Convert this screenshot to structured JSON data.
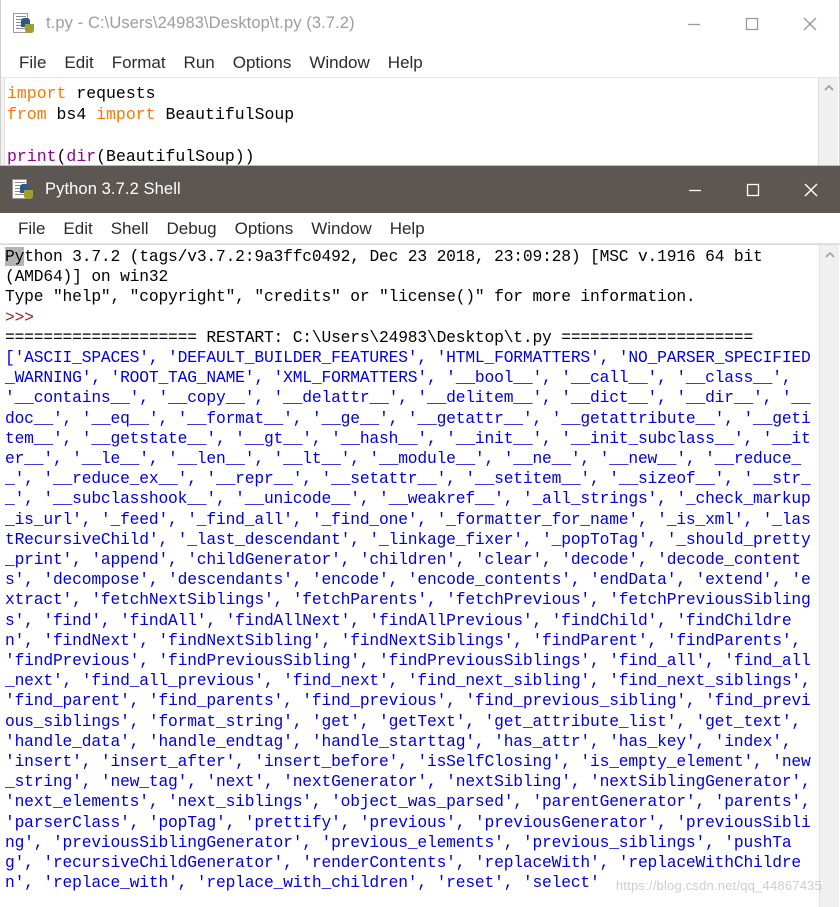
{
  "editor_window": {
    "title": "t.py - C:\\Users\\24983\\Desktop\\t.py (3.7.2)",
    "icon": "python-file-icon",
    "active": false,
    "controls": {
      "minimize": "minimize-icon",
      "maximize": "maximize-icon",
      "close": "close-icon"
    },
    "menu": [
      "File",
      "Edit",
      "Format",
      "Run",
      "Options",
      "Window",
      "Help"
    ],
    "code": {
      "line1_kw": "import",
      "line1_rest": " requests",
      "line2_kw1": "from",
      "line2_mid": " bs4 ",
      "line2_kw2": "import",
      "line2_rest": " BeautifulSoup",
      "line3": "",
      "line4_bi1": "print",
      "line4_p1": "(",
      "line4_bi2": "dir",
      "line4_rest": "(BeautifulSoup))"
    }
  },
  "shell_window": {
    "title": "Python 3.7.2 Shell",
    "icon": "python-file-icon",
    "active": true,
    "controls": {
      "minimize": "minimize-icon",
      "maximize": "maximize-icon",
      "close": "close-icon"
    },
    "menu": [
      "File",
      "Edit",
      "Shell",
      "Debug",
      "Options",
      "Window",
      "Help"
    ],
    "banner": {
      "selected_prefix": "Py",
      "line1_rest": "thon 3.7.2 (tags/v3.7.2:9a3ffc0492, Dec 23 2018, 23:09:28) [MSC v.1916 64 bit",
      "line2": "(AMD64)] on win32",
      "line3": "Type \"help\", \"copyright\", \"credits\" or \"license()\" for more information.",
      "prompt": ">>> ",
      "restart": "==================== RESTART: C:\\Users\\24983\\Desktop\\t.py ===================="
    },
    "output": "['ASCII_SPACES', 'DEFAULT_BUILDER_FEATURES', 'HTML_FORMATTERS', 'NO_PARSER_SPECIFIED_WARNING', 'ROOT_TAG_NAME', 'XML_FORMATTERS', '__bool__', '__call__', '__class__', '__contains__', '__copy__', '__delattr__', '__delitem__', '__dict__', '__dir__', '__doc__', '__eq__', '__format__', '__ge__', '__getattr__', '__getattribute__', '__getitem__', '__getstate__', '__gt__', '__hash__', '__init__', '__init_subclass__', '__iter__', '__le__', '__len__', '__lt__', '__module__', '__ne__', '__new__', '__reduce__', '__reduce_ex__', '__repr__', '__setattr__', '__setitem__', '__sizeof__', '__str__', '__subclasshook__', '__unicode__', '__weakref__', '_all_strings', '_check_markup_is_url', '_feed', '_find_all', '_find_one', '_formatter_for_name', '_is_xml', '_lastRecursiveChild', '_last_descendant', '_linkage_fixer', '_popToTag', '_should_pretty_print', 'append', 'childGenerator', 'children', 'clear', 'decode', 'decode_contents', 'decompose', 'descendants', 'encode', 'encode_contents', 'endData', 'extend', 'extract', 'fetchNextSiblings', 'fetchParents', 'fetchPrevious', 'fetchPreviousSiblings', 'find', 'findAll', 'findAllNext', 'findAllPrevious', 'findChild', 'findChildren', 'findNext', 'findNextSibling', 'findNextSiblings', 'findParent', 'findParents', 'findPrevious', 'findPreviousSibling', 'findPreviousSiblings', 'find_all', 'find_all_next', 'find_all_previous', 'find_next', 'find_next_sibling', 'find_next_siblings', 'find_parent', 'find_parents', 'find_previous', 'find_previous_sibling', 'find_previous_siblings', 'format_string', 'get', 'getText', 'get_attribute_list', 'get_text', 'handle_data', 'handle_endtag', 'handle_starttag', 'has_attr', 'has_key', 'index', 'insert', 'insert_after', 'insert_before', 'isSelfClosing', 'is_empty_element', 'new_string', 'new_tag', 'next', 'nextGenerator', 'nextSibling', 'nextSiblingGenerator', 'next_elements', 'next_siblings', 'object_was_parsed', 'parentGenerator', 'parents', 'parserClass', 'popTag', 'prettify', 'previous', 'previousGenerator', 'previousSibling', 'previousSiblingGenerator', 'previous_elements', 'previous_siblings', 'pushTag', 'recursiveChildGenerator', 'renderContents', 'replaceWith', 'replaceWithChildren', 'replace_with', 'replace_with_children', 'reset', 'select'"
  },
  "watermark": "https://blog.csdn.net/qq_44867435",
  "colors": {
    "active_titlebar": "#5c5753",
    "inactive_titlebar": "#ffffff",
    "keyword": "#ff7700",
    "builtin": "#900090",
    "shell_output": "#0000dd",
    "prompt": "#a02020",
    "selection": "#b4b4b4"
  }
}
